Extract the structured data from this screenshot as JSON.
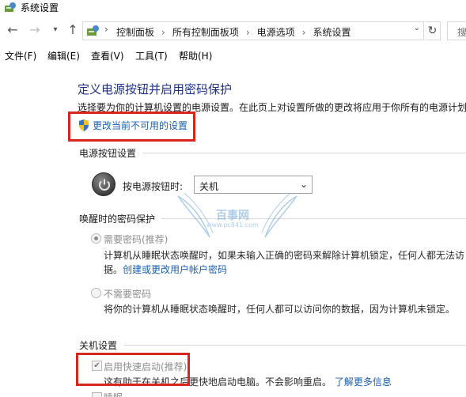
{
  "window": {
    "title": "系统设置"
  },
  "address": {
    "crumbs": [
      "控制面板",
      "所有控制面板项",
      "电源选项",
      "系统设置"
    ],
    "search_placeholder": "搜"
  },
  "menu": {
    "items": [
      "文件(F)",
      "编辑(E)",
      "查看(V)",
      "工具(T)",
      "帮助(H)"
    ]
  },
  "main": {
    "heading": "定义电源按钮并启用密码保护",
    "description": "选择要为你的计算机设置的电源设置。在此页上对设置所做的更改将应用于你所有的电源计划",
    "change_link": "更改当前不可用的设置",
    "power_section": {
      "title": "电源按钮设置",
      "label": "按电源按钮时:",
      "selected": "关机"
    },
    "password_section": {
      "title": "唤醒时的密码保护",
      "require": {
        "label": "需要密码(推荐)",
        "desc_line1": "计算机从睡眠状态唤醒时，如果未输入正确的密码来解除计算机锁定，任何人都无法访",
        "desc_prefix": "据。",
        "link": "创建或更改用户帐户密码"
      },
      "no_require": {
        "label": "不需要密码",
        "desc": "将你的计算机从睡眠状态唤醒时，任何人都可以访问你的数据，因为计算机未锁定。"
      }
    },
    "shutdown_section": {
      "title": "关机设置",
      "fast_startup": {
        "label": "启用快速启动(推荐)",
        "desc": "这有助于在关机之后更快地启动电脑。不会影响重启。",
        "link": "了解更多信息"
      },
      "sleep_label": "睡眠"
    }
  },
  "watermark": {
    "text": "百事网",
    "url": "www.pc841.com"
  },
  "colors": {
    "heading": "#1e3287",
    "link": "#1a5fb4",
    "highlight": "#d7261e"
  }
}
